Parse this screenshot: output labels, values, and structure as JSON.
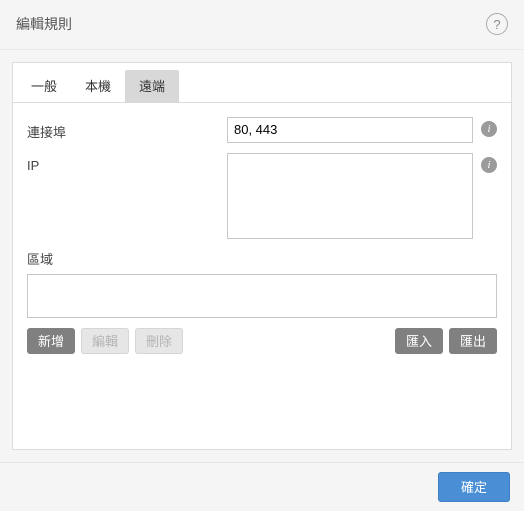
{
  "dialog": {
    "title": "編輯規則",
    "help_glyph": "?"
  },
  "tabs": [
    {
      "label": "一般",
      "active": false
    },
    {
      "label": "本機",
      "active": false
    },
    {
      "label": "遠端",
      "active": true
    }
  ],
  "form": {
    "port": {
      "label": "連接埠",
      "value": "80, 443"
    },
    "ip": {
      "label": "IP",
      "value": ""
    },
    "zone": {
      "label": "區域"
    }
  },
  "info_glyph": "i",
  "buttons": {
    "add": "新增",
    "edit": "編輯",
    "delete": "刪除",
    "import": "匯入",
    "export": "匯出"
  },
  "footer": {
    "ok": "確定"
  }
}
